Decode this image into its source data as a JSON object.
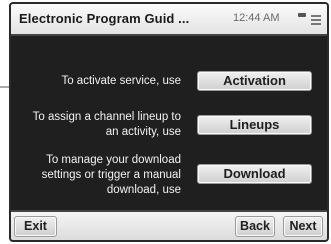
{
  "window": {
    "title": "Electronic Program Guid ...",
    "clock": "12:44 AM"
  },
  "rows": [
    {
      "description": "To activate service, use",
      "button_label": "Activation"
    },
    {
      "description": "To assign a channel lineup to an activity, use",
      "button_label": "Lineups"
    },
    {
      "description": "To manage your download settings or trigger a manual download, use",
      "button_label": "Download"
    }
  ],
  "footer": {
    "exit_label": "Exit",
    "back_label": "Back",
    "next_label": "Next"
  }
}
